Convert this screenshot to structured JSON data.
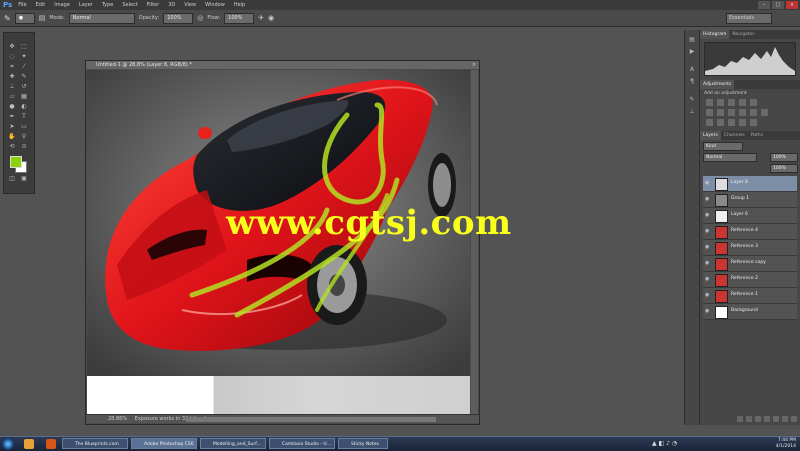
{
  "app": {
    "logo": "Ps",
    "menus": [
      "File",
      "Edit",
      "Image",
      "Layer",
      "Type",
      "Select",
      "Filter",
      "3D",
      "View",
      "Window",
      "Help"
    ],
    "workspace": "Essentials"
  },
  "options": {
    "mode_label": "Mode:",
    "mode_value": "Normal",
    "opacity_label": "Opacity:",
    "opacity_value": "100%",
    "flow_label": "Flow:",
    "flow_value": "100%"
  },
  "document": {
    "title": "Untitled-1 @ 28.8% (Layer 8, RGB/8) *",
    "zoom": "28.86%",
    "doc_info": "Exposure works in 32-bit only",
    "watermark": "www.cgtsj.com"
  },
  "panels": {
    "top_tabs": [
      "Histogram",
      "Navigator"
    ],
    "adjustments_tab": "Adjustments",
    "adjustments_title": "Add an adjustment",
    "layer_tabs": [
      "Layers",
      "Channels",
      "Paths"
    ],
    "kind": "Kind",
    "blend_mode": "Normal",
    "opacity": "100%",
    "fill": "100%",
    "layers": [
      {
        "name": "Layer 8",
        "selected": true
      },
      {
        "name": "Group 1",
        "selected": false
      },
      {
        "name": "Layer 6",
        "selected": false
      },
      {
        "name": "Reference 4",
        "selected": false
      },
      {
        "name": "Reference 3",
        "selected": false
      },
      {
        "name": "Reference copy",
        "selected": false
      },
      {
        "name": "Reference 2",
        "selected": false
      },
      {
        "name": "Reference 1",
        "selected": false
      },
      {
        "name": "Background",
        "selected": false
      }
    ]
  },
  "taskbar": {
    "tasks": [
      {
        "label": "The Blueprints.com",
        "active": false
      },
      {
        "label": "Adobe Photoshop CS6",
        "active": true
      },
      {
        "label": "Modelling_and_Surf...",
        "active": false
      },
      {
        "label": "Camtasia Studio - U...",
        "active": false
      },
      {
        "label": "Sticky Notes",
        "active": false
      }
    ],
    "time": "7:44 PM",
    "date": "4/1/2014"
  }
}
